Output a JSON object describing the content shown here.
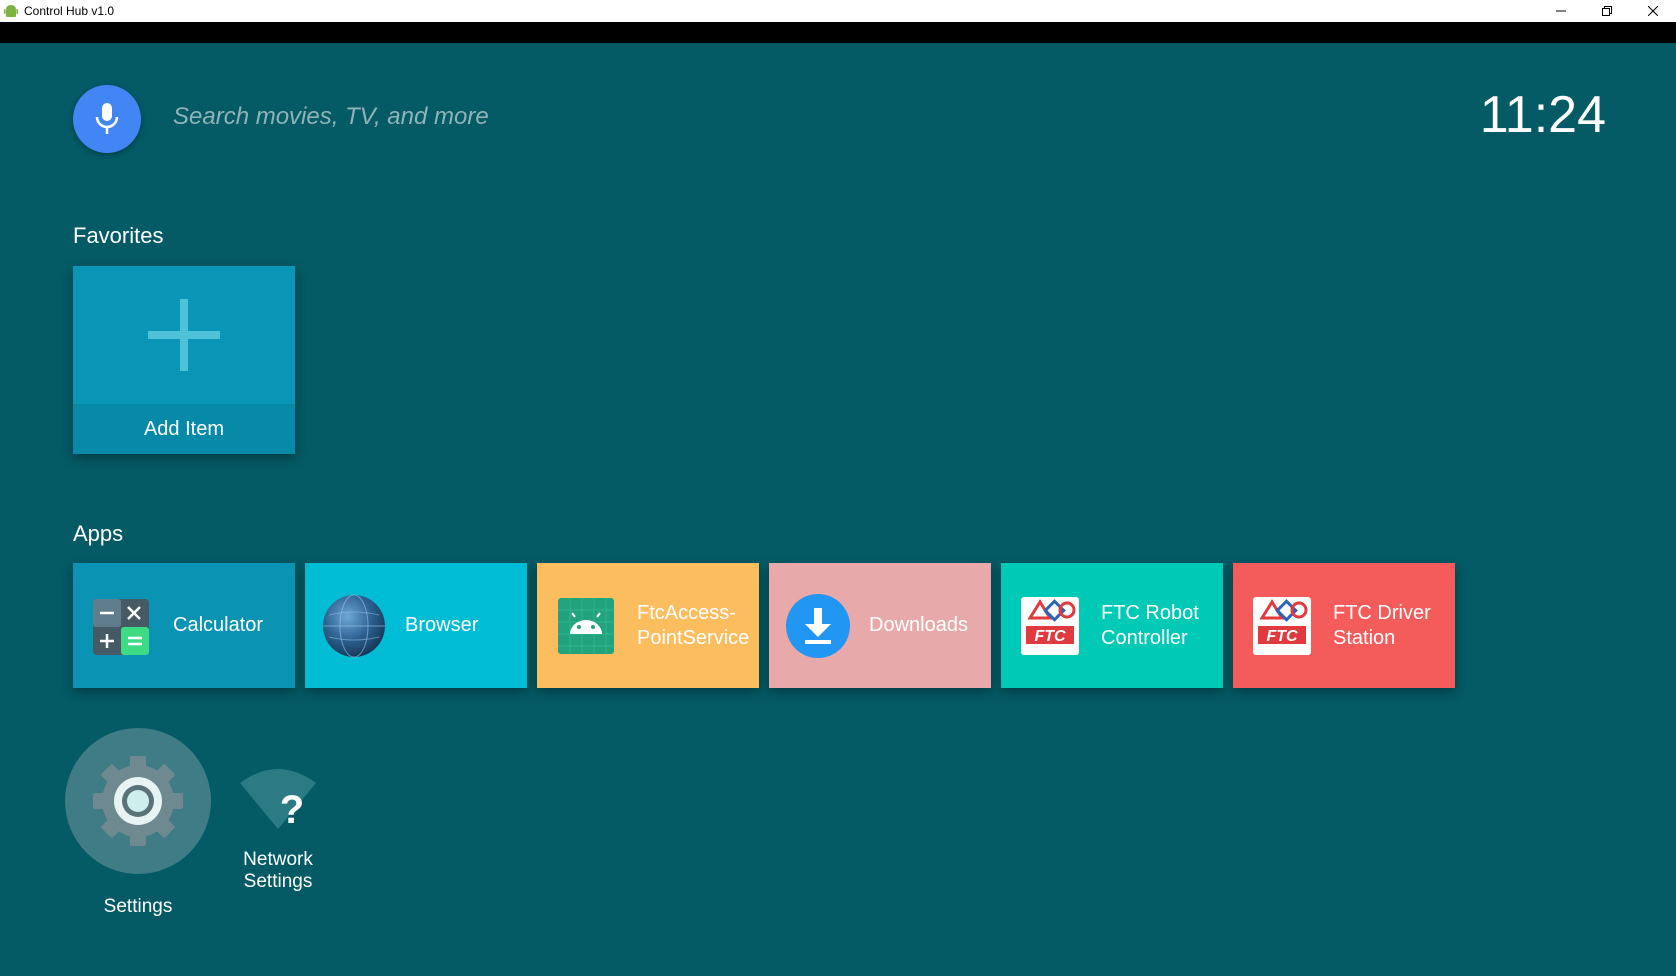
{
  "window": {
    "title": "Control Hub v1.0",
    "controls": [
      "minimize-icon",
      "restore-icon",
      "close-icon"
    ]
  },
  "search": {
    "placeholder": "Search movies, TV, and more",
    "icon": "mic-icon"
  },
  "clock": "11:24",
  "favorites": {
    "title": "Favorites",
    "add_item_label": "Add Item"
  },
  "apps": {
    "title": "Apps",
    "items": [
      {
        "label": "Calculator",
        "color": "#0a93b3",
        "icon": "calculator-icon"
      },
      {
        "label": "Browser",
        "color": "#00bcd4",
        "icon": "globe-icon"
      },
      {
        "label": "FtcAccess-PointService",
        "line1": "FtcAccess-",
        "line2": "PointService",
        "color": "#fbbd5e",
        "icon": "android-icon"
      },
      {
        "label": "Downloads",
        "color": "#e8a9aa",
        "icon": "download-icon"
      },
      {
        "label": "FTC Robot Controller",
        "line1": "FTC Robot",
        "line2": "Controller",
        "color": "#00c9b5",
        "icon": "ftc-logo-icon"
      },
      {
        "label": "FTC Driver Station",
        "line1": "FTC Driver",
        "line2": "Station",
        "color": "#f45b5b",
        "icon": "ftc-logo-icon"
      }
    ]
  },
  "settings": {
    "label": "Settings",
    "icon": "gear-icon"
  },
  "network_settings": {
    "line1": "Network",
    "line2": "Settings",
    "icon": "wifi-question-icon"
  },
  "colors": {
    "background": "#045a65",
    "mic_button": "#4285f4",
    "add_tile": "#0a96b6"
  }
}
